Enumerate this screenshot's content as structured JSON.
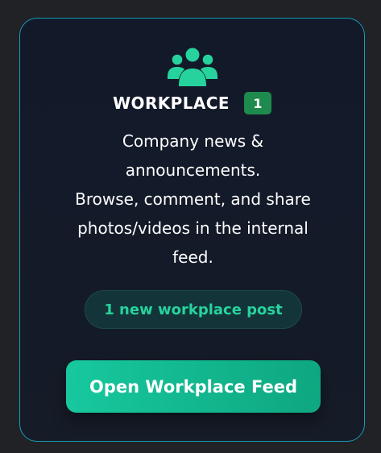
{
  "card": {
    "icon": "users-group-icon",
    "title": "WORKPLACE",
    "badge_count": "1",
    "description_lines": [
      "Company news &",
      "announcements.",
      "Browse, comment, and share",
      "photos/videos in the internal",
      "feed."
    ],
    "status_pill": "1 new workplace post",
    "open_button_label": "Open Workplace Feed"
  },
  "colors": {
    "page_background": "#202225",
    "card_background": "#151b27",
    "card_border": "#1a9bb8",
    "accent_green": "#27d39d",
    "badge_green": "#1f8a4d",
    "button_gradient_start": "#17c89e",
    "button_gradient_end": "#0ea780",
    "text_primary": "#ffffff"
  }
}
